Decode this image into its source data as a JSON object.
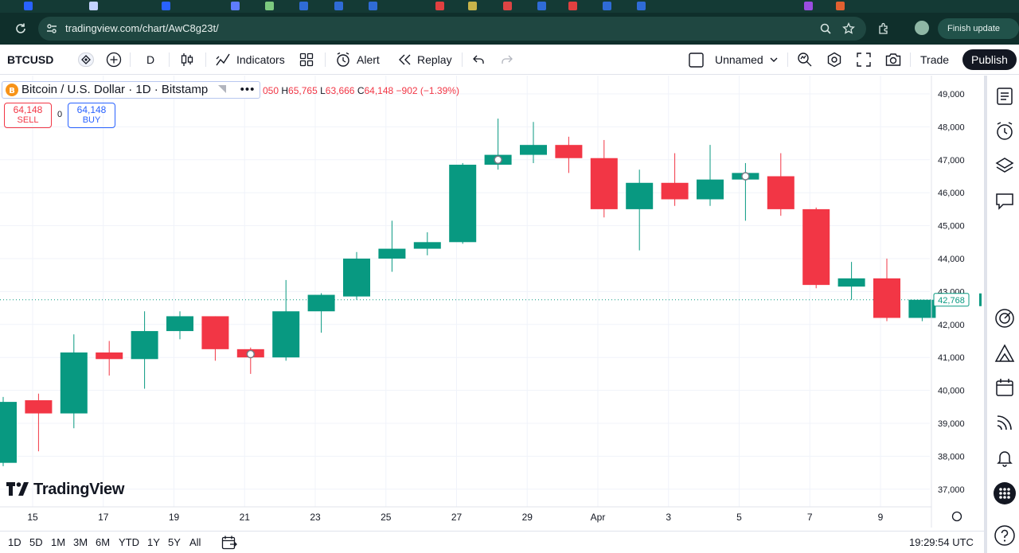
{
  "browser": {
    "url": "tradingview.com/chart/AwC8g23t/",
    "finish_update": "Finish update"
  },
  "toolbar": {
    "symbol": "BTCUSD",
    "interval": "D",
    "indicators": "Indicators",
    "alert": "Alert",
    "replay": "Replay",
    "layout_name": "Unnamed",
    "trade": "Trade",
    "publish": "Publish"
  },
  "legend": {
    "title": "Bitcoin / U.S. Dollar · 1D · Bitstamp",
    "ohlc_prefix": "050",
    "h_label": "H",
    "h_value": "65,765",
    "l_label": "L",
    "l_value": "63,666",
    "c_label": "C",
    "c_value": "64,148",
    "change": "−902 (−1.39%)",
    "sell_price": "64,148",
    "sell_label": "SELL",
    "spread": "0",
    "buy_price": "64,148",
    "buy_label": "BUY"
  },
  "logo_text": "TradingView",
  "bottom": {
    "ranges": [
      "1D",
      "5D",
      "1M",
      "3M",
      "6M",
      "YTD",
      "1Y",
      "5Y",
      "All"
    ],
    "clock": "19:29:54 UTC"
  },
  "colors": {
    "up": "#089981",
    "down": "#f23645",
    "toolbar_bg": "#0f2f2b"
  },
  "icons": {
    "sidebar": [
      "watchlist-icon",
      "alarm-clock-icon",
      "layers-icon",
      "chat-icon",
      "target-icon",
      "ideas-icon",
      "calendar-icon",
      "stream-icon",
      "bell-icon",
      "apps-grid-icon",
      "help-icon"
    ]
  },
  "chart_data": {
    "type": "candlestick",
    "x_tick_labels": [
      "15",
      "17",
      "19",
      "21",
      "23",
      "25",
      "27",
      "29",
      "Apr",
      "3",
      "5",
      "7",
      "9"
    ],
    "y_tick_labels": [
      "49,000",
      "48,000",
      "47,000",
      "46,000",
      "45,000",
      "44,000",
      "43,000",
      "42,000",
      "41,000",
      "40,000",
      "39,000",
      "38,000",
      "37,000"
    ],
    "ylim": [
      36600,
      49400
    ],
    "last_price_label": "42,768",
    "candles": [
      {
        "o": 37800,
        "h": 39800,
        "l": 37700,
        "c": 39650
      },
      {
        "o": 39700,
        "h": 39900,
        "l": 38150,
        "c": 39300
      },
      {
        "o": 39300,
        "h": 41700,
        "l": 38850,
        "c": 41150
      },
      {
        "o": 41150,
        "h": 41500,
        "l": 40450,
        "c": 40950
      },
      {
        "o": 40950,
        "h": 42400,
        "l": 40050,
        "c": 41800
      },
      {
        "o": 41800,
        "h": 42400,
        "l": 41550,
        "c": 42250
      },
      {
        "o": 42250,
        "h": 42250,
        "l": 40900,
        "c": 41250
      },
      {
        "o": 41250,
        "h": 41300,
        "l": 40500,
        "c": 41000
      },
      {
        "o": 41000,
        "h": 43350,
        "l": 40900,
        "c": 42400
      },
      {
        "o": 42400,
        "h": 42950,
        "l": 41750,
        "c": 42900
      },
      {
        "o": 42850,
        "h": 44200,
        "l": 42750,
        "c": 44000
      },
      {
        "o": 44000,
        "h": 45150,
        "l": 43600,
        "c": 44300
      },
      {
        "o": 44300,
        "h": 44800,
        "l": 44100,
        "c": 44500
      },
      {
        "o": 44500,
        "h": 46900,
        "l": 44450,
        "c": 46850
      },
      {
        "o": 46850,
        "h": 48250,
        "l": 46700,
        "c": 47150
      },
      {
        "o": 47150,
        "h": 48150,
        "l": 46900,
        "c": 47450
      },
      {
        "o": 47450,
        "h": 47700,
        "l": 46600,
        "c": 47050
      },
      {
        "o": 47050,
        "h": 47600,
        "l": 45250,
        "c": 45500
      },
      {
        "o": 45500,
        "h": 46700,
        "l": 44250,
        "c": 46300
      },
      {
        "o": 46300,
        "h": 47200,
        "l": 45600,
        "c": 45800
      },
      {
        "o": 45800,
        "h": 47450,
        "l": 45600,
        "c": 46400
      },
      {
        "o": 46400,
        "h": 46900,
        "l": 45150,
        "c": 46600
      },
      {
        "o": 46500,
        "h": 47200,
        "l": 45300,
        "c": 45500
      },
      {
        "o": 45500,
        "h": 45550,
        "l": 43100,
        "c": 43200
      },
      {
        "o": 43150,
        "h": 43900,
        "l": 42750,
        "c": 43400
      },
      {
        "o": 43400,
        "h": 44000,
        "l": 42100,
        "c": 42200
      },
      {
        "o": 42200,
        "h": 42750,
        "l": 42100,
        "c": 42750
      }
    ]
  }
}
